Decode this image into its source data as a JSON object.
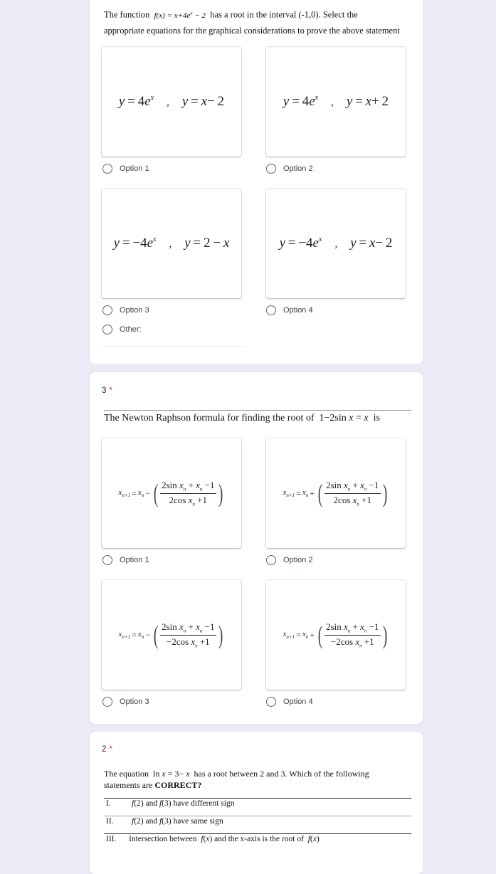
{
  "colors": {
    "background": "#ede9f7",
    "card": "#ffffff",
    "required_star": "#d93025",
    "radio_border": "#5f6368"
  },
  "question_1": {
    "text_parts": {
      "prefix": "The function",
      "formula": "f(x) = x + 4e^x − 2",
      "suffix_line1": "has a root in the interval (-1,0). Select the",
      "line2": "appropriate equations for the graphical considerations to prove the above statement"
    },
    "options": [
      {
        "label": "Option 1",
        "eq_a": "y = 4e^x",
        "eq_b": "y = x − 2"
      },
      {
        "label": "Option 2",
        "eq_a": "y = 4e^x",
        "eq_b": "y = x + 2"
      },
      {
        "label": "Option 3",
        "eq_a": "y = −4e^x",
        "eq_b": "y = 2 − x"
      },
      {
        "label": "Option 4",
        "eq_a": "y = −4e^x",
        "eq_b": "y = x − 2"
      }
    ],
    "other_label": "Other:",
    "other_value": ""
  },
  "question_2": {
    "number": "3",
    "required": "*",
    "text": "The Newton Raphson formula for finding the root of",
    "formula": "1 − 2sin x = x",
    "text_end": "is",
    "options": [
      {
        "label": "Option 1",
        "lhs": "x_{n+1} = x_n",
        "op": "−",
        "numerator": "2sin x_n + x_n − 1",
        "denominator": "2cos x_n + 1"
      },
      {
        "label": "Option 2",
        "lhs": "x_{n+1} = x_n",
        "op": "+",
        "numerator": "2sin x_n + x_n − 1",
        "denominator": "2cos x_n + 1"
      },
      {
        "label": "Option 3",
        "lhs": "x_{n+1} = x_n",
        "op": "−",
        "numerator": "2sin x_n + x_n − 1",
        "denominator": "−2cos x_n + 1"
      },
      {
        "label": "Option 4",
        "lhs": "x_{n+1} = x_n",
        "op": "+",
        "numerator": "2sin x_n + x_n − 1",
        "denominator": "−2cos x_n + 1"
      }
    ]
  },
  "question_3": {
    "number": "2",
    "required": "*",
    "text_line1_a": "The equation",
    "formula": "ln x = 3 − x",
    "text_line1_b": "has a root between 2 and 3. Which of the following",
    "text_line2": "statements are",
    "text_bold": "CORRECT?",
    "statements": [
      {
        "num": "I.",
        "text": "f(2) and f(3) have different sign"
      },
      {
        "num": "II.",
        "text": "f(2) and f(3) have same sign"
      },
      {
        "num": "III.",
        "text": "Intersection between f(x) and the x-axis is the root of f(x)"
      }
    ]
  }
}
